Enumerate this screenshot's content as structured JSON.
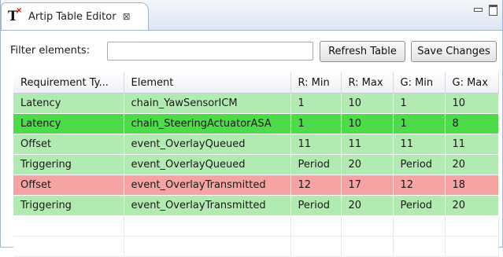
{
  "view": {
    "title": "Artip Table Editor",
    "icon": "T",
    "icon_badge": "×",
    "close_glyph": "⊠"
  },
  "filter": {
    "label": "Filter elements:",
    "value": "",
    "placeholder": ""
  },
  "buttons": {
    "refresh": "Refresh Table",
    "save": "Save Changes"
  },
  "table": {
    "columns": [
      "Requirement Ty...",
      "Element",
      "R: Min",
      "R: Max",
      "G: Min",
      "G: Max"
    ],
    "rows": [
      {
        "status": "pass",
        "cells": [
          "Latency",
          "chain_YawSensorICM",
          "1",
          "10",
          "1",
          "10"
        ]
      },
      {
        "status": "selected",
        "cells": [
          "Latency",
          "chain_SteeringActuatorASA",
          "1",
          "10",
          "1",
          "8"
        ]
      },
      {
        "status": "pass",
        "cells": [
          "Offset",
          "event_OverlayQueued",
          "11",
          "11",
          "11",
          "11"
        ]
      },
      {
        "status": "pass",
        "cells": [
          "Triggering",
          "event_OverlayQueued",
          "Period",
          "20",
          "Period",
          "20"
        ]
      },
      {
        "status": "fail",
        "cells": [
          "Offset",
          "event_OverlayTransmitted",
          "12",
          "17",
          "12",
          "18"
        ]
      },
      {
        "status": "pass",
        "cells": [
          "Triggering",
          "event_OverlayTransmitted",
          "Period",
          "20",
          "Period",
          "20"
        ]
      }
    ]
  },
  "colors": {
    "pass": "#b2ebb1",
    "selected": "#4ddb4a",
    "fail": "#f5a3a3"
  },
  "icons": {
    "tab": "artip-t-icon",
    "close": "close-icon",
    "minimize": "minimize-icon",
    "maximize": "maximize-icon"
  }
}
